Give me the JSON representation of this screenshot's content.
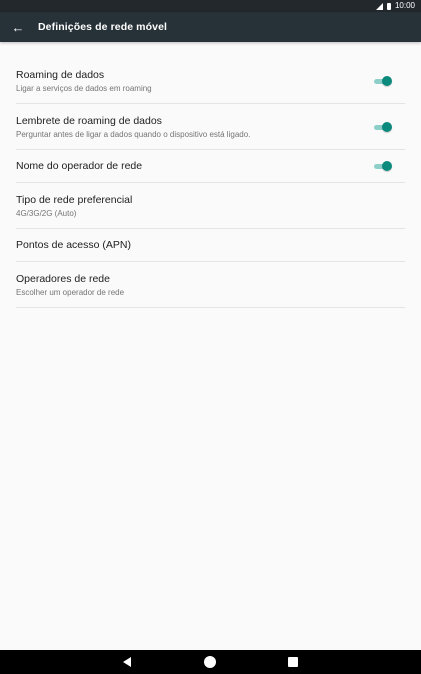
{
  "status_bar": {
    "time": "10:00"
  },
  "app_bar": {
    "title": "Definições de rede móvel"
  },
  "settings": [
    {
      "title": "Roaming de dados",
      "subtitle": "Ligar a serviços de dados em roaming",
      "toggle": true
    },
    {
      "title": "Lembrete de roaming de dados",
      "subtitle": "Perguntar antes de ligar a dados quando o dispositivo está ligado.",
      "toggle": true
    },
    {
      "title": "Nome do operador de rede",
      "toggle": true
    },
    {
      "title": "Tipo de rede preferencial",
      "subtitle": "4G/3G/2G (Auto)"
    },
    {
      "title": "Pontos de acesso (APN)"
    },
    {
      "title": "Operadores de rede",
      "subtitle": "Escolher um operador de rede"
    }
  ],
  "colors": {
    "app_bar": "#273238",
    "accent": "#0a8a7d",
    "background": "#fafafa"
  },
  "icons": {
    "back": "arrow-back-icon",
    "nav_back": "nav-back-icon",
    "nav_home": "nav-home-icon",
    "nav_recent": "nav-recent-icon"
  }
}
